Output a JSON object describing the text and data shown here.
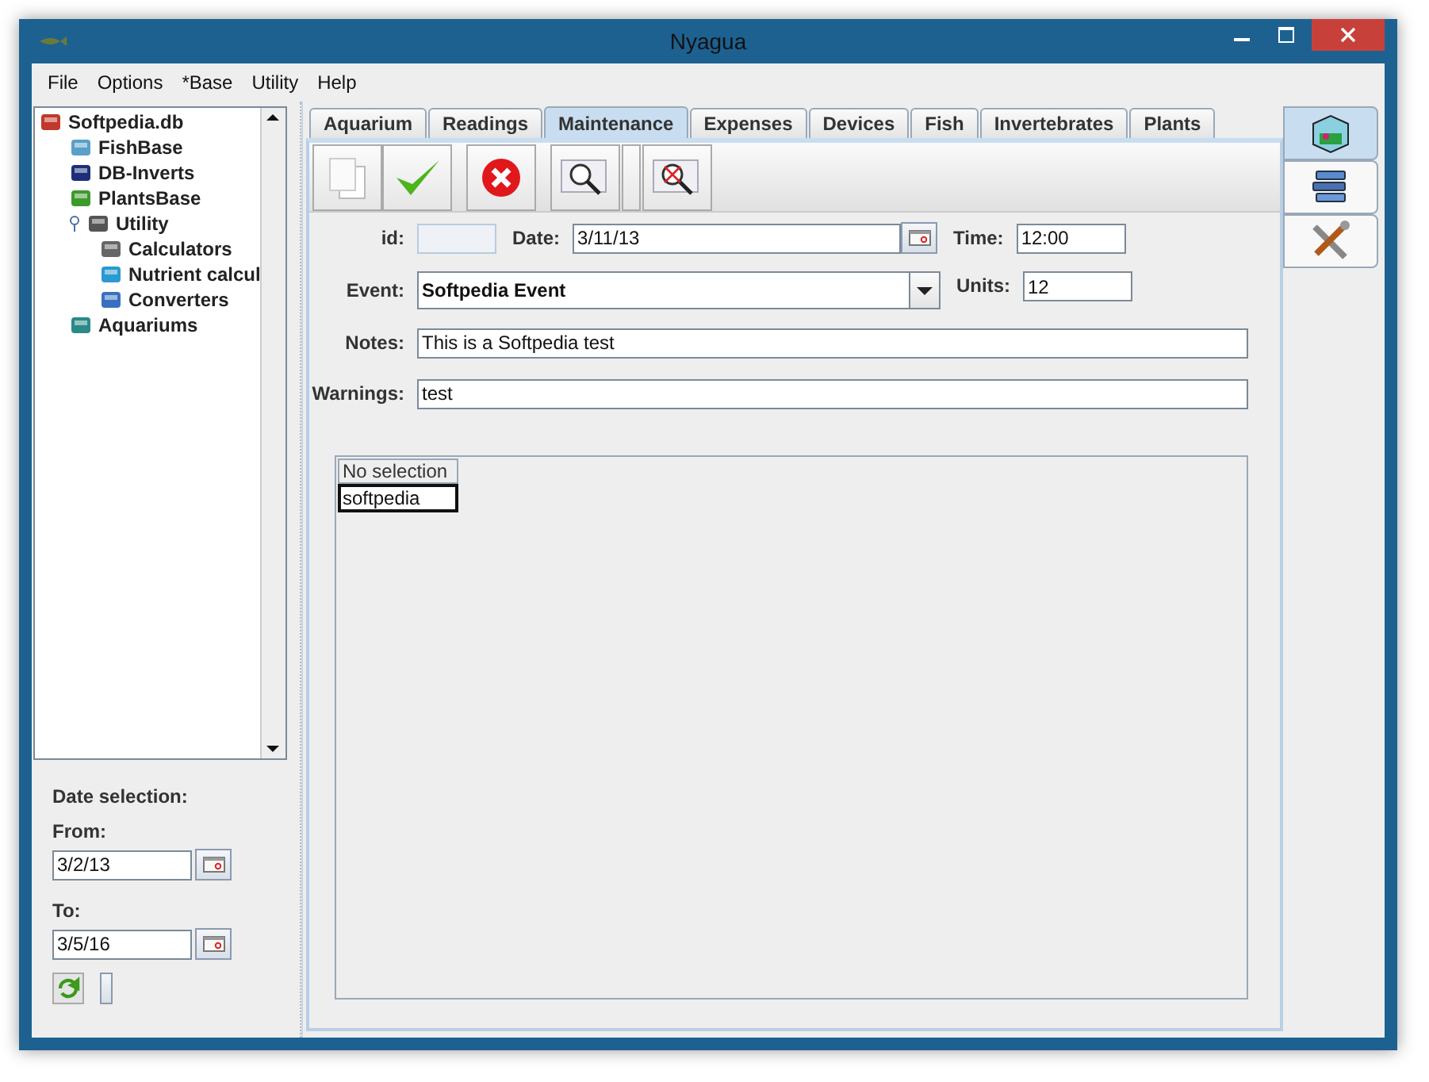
{
  "window": {
    "title": "Nyagua"
  },
  "menu": [
    "File",
    "Options",
    "*Base",
    "Utility",
    "Help"
  ],
  "tree": {
    "label": "Softpedia.db",
    "children": [
      {
        "label": "FishBase"
      },
      {
        "label": "DB-Inverts"
      },
      {
        "label": "PlantsBase"
      },
      {
        "label": "Utility",
        "expanded": true,
        "children": [
          {
            "label": "Calculators"
          },
          {
            "label": "Nutrient calcul"
          },
          {
            "label": "Converters"
          }
        ]
      },
      {
        "label": "Aquariums"
      }
    ]
  },
  "date_selection": {
    "title": "Date selection:",
    "from_label": "From:",
    "from": "3/2/13",
    "to_label": "To:",
    "to": "3/5/16"
  },
  "tabs": [
    {
      "label": "Aquarium",
      "selected": false
    },
    {
      "label": "Readings",
      "selected": false
    },
    {
      "label": "Maintenance",
      "selected": true
    },
    {
      "label": "Expenses",
      "selected": false
    },
    {
      "label": "Devices",
      "selected": false
    },
    {
      "label": "Fish",
      "selected": false
    },
    {
      "label": "Invertebrates",
      "selected": false
    },
    {
      "label": "Plants",
      "selected": false
    }
  ],
  "side_tabs": [
    {
      "selected": true
    },
    {
      "selected": false
    },
    {
      "selected": false
    }
  ],
  "form": {
    "id_label": "id:",
    "date_label": "Date:",
    "date": "3/11/13",
    "time_label": "Time:",
    "time": "12:00",
    "event_label": "Event:",
    "event": "Softpedia Event",
    "units_label": "Units:",
    "units": "12",
    "notes_label": "Notes:",
    "notes": "This is a Softpedia test",
    "warnings_label": "Warnings:",
    "warnings": "test"
  },
  "table": {
    "columns": [
      "No selection"
    ],
    "rows": [
      {
        "cells": [
          "softpedia"
        ],
        "selected": true
      }
    ]
  }
}
